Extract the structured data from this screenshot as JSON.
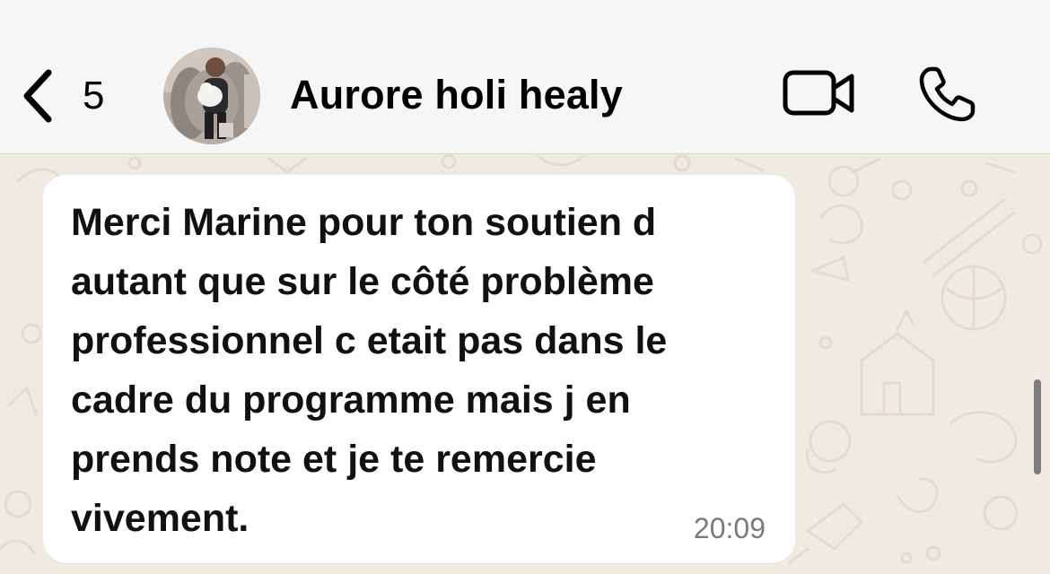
{
  "header": {
    "back_count": "5",
    "contact_name": "Aurore holi healy"
  },
  "message": {
    "text": "Merci Marine pour ton soutien d\nautant que sur le côté problème\nprofessionnel c etait pas dans le\ncadre du programme mais j en\nprends note et je te remercie\nvivement.",
    "time": "20:09"
  },
  "icons": {
    "back": "chevron-left-icon",
    "video": "video-camera-icon",
    "call": "phone-icon"
  },
  "colors": {
    "header_bg": "#f6f6f6",
    "chat_bg": "#efeae2",
    "bubble_bg": "#ffffff",
    "timestamp": "#7a7a7a"
  }
}
